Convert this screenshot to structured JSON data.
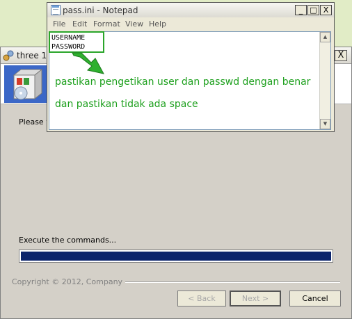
{
  "installer": {
    "title": "three 1",
    "prompt": "Please w",
    "status": "Execute the commands...",
    "progress": 1.0,
    "copyright": "Copyright © 2012, Company",
    "buttons": {
      "back": "< Back",
      "next": "Next >",
      "cancel": "Cancel"
    }
  },
  "notepad": {
    "title": "pass.ini - Notepad",
    "controls": {
      "minimize": "_",
      "maximize": "□",
      "close": "X"
    },
    "menu": [
      "File",
      "Edit",
      "Format",
      "View",
      "Help"
    ],
    "content": [
      "USERNAME",
      "PASSWORD"
    ]
  },
  "annotation": {
    "line1": "pastikan pengetikan user dan passwd dengan benar",
    "line2": "dan pastikan tidak ada space",
    "color": "#1ea01e"
  },
  "colors": {
    "progress": "#0b246b",
    "desktop": "#e1ecc6"
  }
}
